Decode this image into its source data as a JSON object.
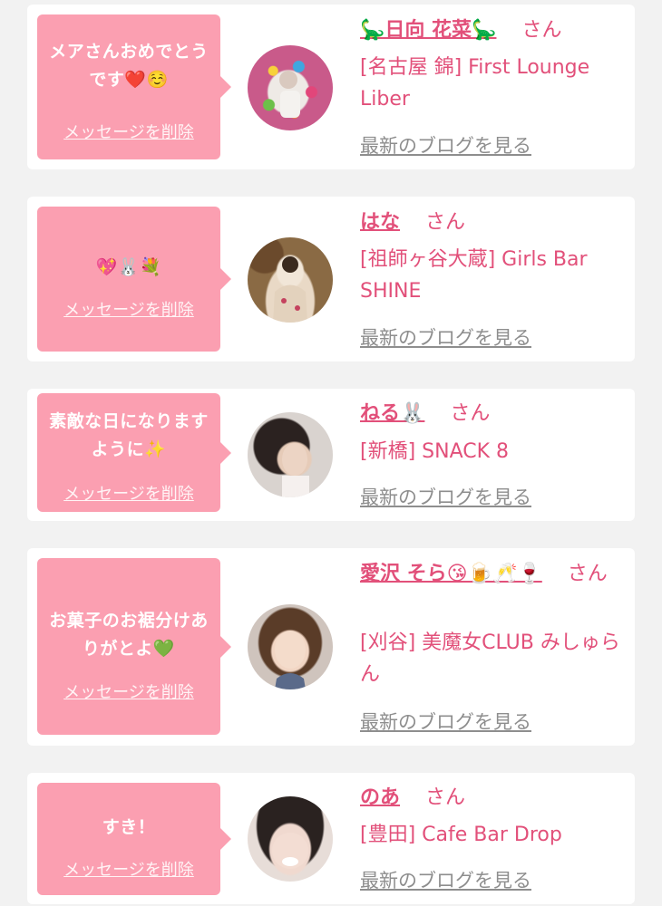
{
  "colors": {
    "background": "#f2f2f2",
    "card": "#ffffff",
    "bubble": "#fb9fb1",
    "accent": "#e2507a",
    "link_gray": "#8e8e8e"
  },
  "messages": [
    {
      "message": "メアさんおめでとうです❤️☺️",
      "delete_label": "メッセージを削除",
      "name": "🦕日向 花菜🦕",
      "honorific": "さん",
      "shop": "[名古屋 錦] First Lounge Liber",
      "blog_label": "最新のブログを見る"
    },
    {
      "message": "💖🐰💐",
      "delete_label": "メッセージを削除",
      "name": "はな",
      "honorific": "さん",
      "shop": "[祖師ヶ谷大蔵] Girls Bar SHINE",
      "blog_label": "最新のブログを見る"
    },
    {
      "message": "素敵な日になりますように✨",
      "delete_label": "メッセージを削除",
      "name": "ねる🐰",
      "honorific": "さん",
      "shop": "[新橋] SNACK 8",
      "blog_label": "最新のブログを見る"
    },
    {
      "message": "お菓子のお裾分けありがとよ💚",
      "delete_label": "メッセージを削除",
      "name": "愛沢 そら😘🍺🥂🍷",
      "honorific": "さん",
      "shop": "[刈谷] 美魔女CLUB みしゅらん",
      "blog_label": "最新のブログを見る"
    },
    {
      "message": "すき！",
      "delete_label": "メッセージを削除",
      "name": "のあ",
      "honorific": "さん",
      "shop": "[豊田] Cafe Bar Drop",
      "blog_label": "最新のブログを見る"
    }
  ]
}
